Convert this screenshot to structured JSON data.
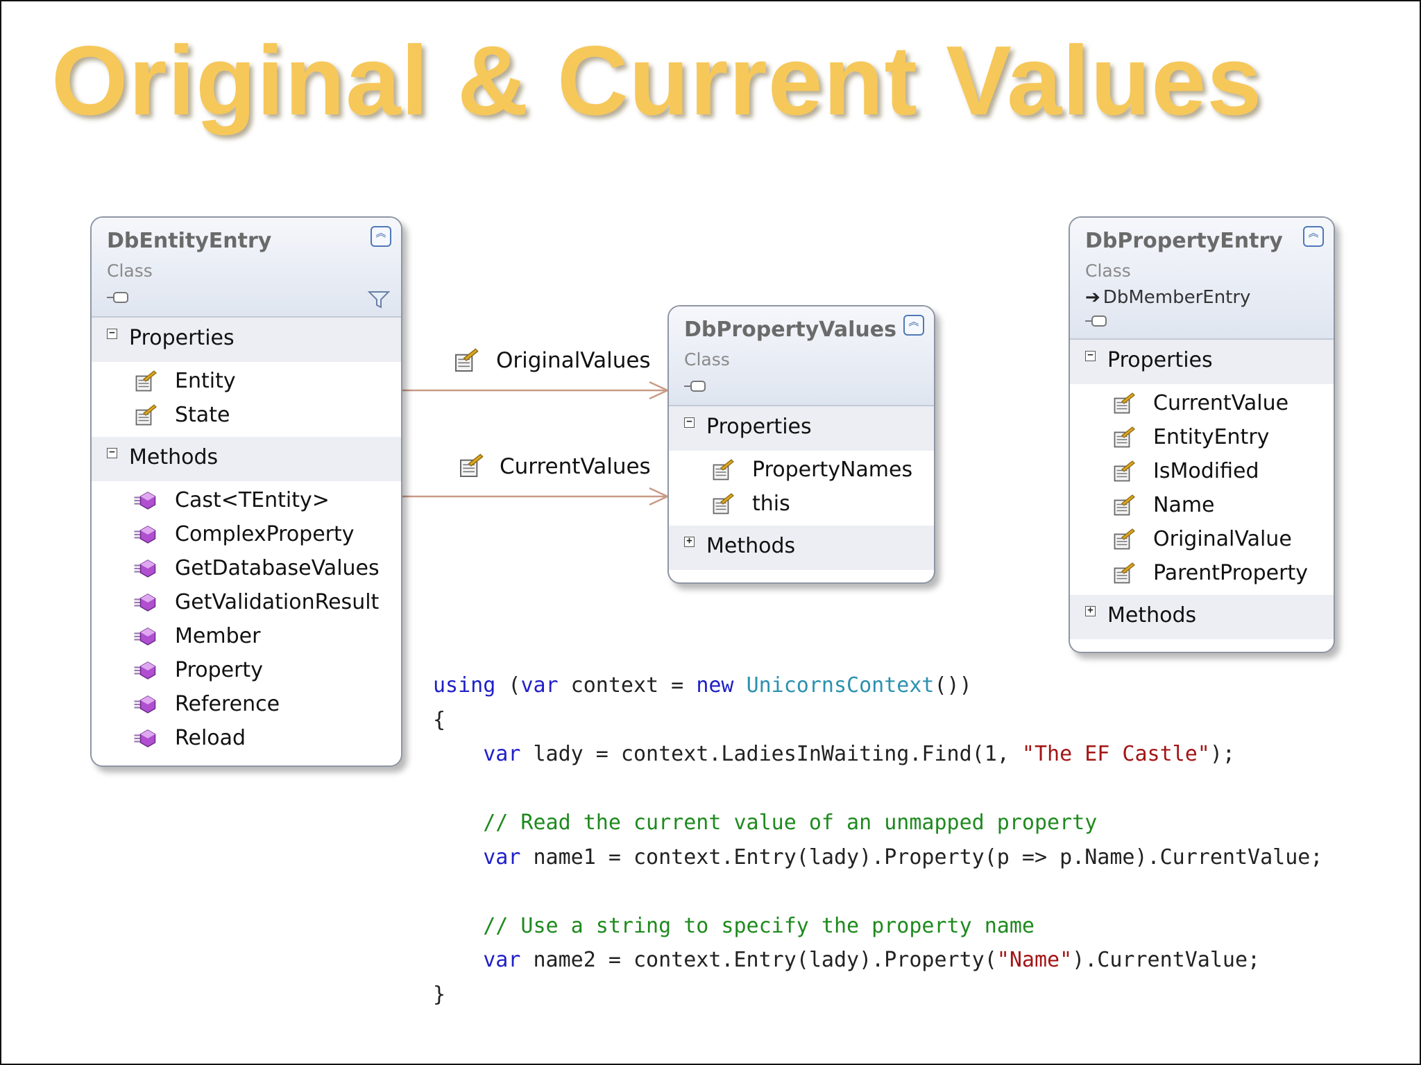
{
  "title": "Original & Current Values",
  "classes": {
    "db_entity_entry": {
      "name": "DbEntityEntry",
      "kind": "Class",
      "sections": [
        {
          "label": "Properties",
          "expanded": true,
          "members": [
            "Entity",
            "State"
          ]
        },
        {
          "label": "Methods",
          "expanded": true,
          "members": [
            "Cast<TEntity>",
            "ComplexProperty",
            "GetDatabaseValues",
            "GetValidationResult",
            "Member",
            "Property",
            "Reference",
            "Reload"
          ]
        }
      ]
    },
    "db_property_values": {
      "name": "DbPropertyValues",
      "kind": "Class",
      "sections": [
        {
          "label": "Properties",
          "expanded": true,
          "members": [
            "PropertyNames",
            "this"
          ]
        },
        {
          "label": "Methods",
          "expanded": false,
          "members": []
        }
      ]
    },
    "db_property_entry": {
      "name": "DbPropertyEntry",
      "kind": "Class",
      "inherits": "DbMemberEntry",
      "sections": [
        {
          "label": "Properties",
          "expanded": true,
          "members": [
            "CurrentValue",
            "EntityEntry",
            "IsModified",
            "Name",
            "OriginalValue",
            "ParentProperty"
          ]
        },
        {
          "label": "Methods",
          "expanded": false,
          "members": []
        }
      ]
    }
  },
  "associations": [
    {
      "label": "OriginalValues",
      "from": "DbEntityEntry",
      "to": "DbPropertyValues"
    },
    {
      "label": "CurrentValues",
      "from": "DbEntityEntry",
      "to": "DbPropertyValues"
    }
  ],
  "code": {
    "language": "csharp",
    "lines": [
      [
        {
          "t": "kw",
          "v": "using"
        },
        {
          "t": "plain",
          "v": " ("
        },
        {
          "t": "kw",
          "v": "var"
        },
        {
          "t": "plain",
          "v": " context = "
        },
        {
          "t": "kw",
          "v": "new"
        },
        {
          "t": "plain",
          "v": " "
        },
        {
          "t": "type",
          "v": "UnicornsContext"
        },
        {
          "t": "plain",
          "v": "())"
        }
      ],
      [
        {
          "t": "plain",
          "v": "{"
        }
      ],
      [
        {
          "t": "plain",
          "v": "    "
        },
        {
          "t": "kw",
          "v": "var"
        },
        {
          "t": "plain",
          "v": " lady = context.LadiesInWaiting.Find(1, "
        },
        {
          "t": "str",
          "v": "\"The EF Castle\""
        },
        {
          "t": "plain",
          "v": ");"
        }
      ],
      [],
      [
        {
          "t": "plain",
          "v": "    "
        },
        {
          "t": "cmt",
          "v": "// Read the current value of an unmapped property"
        }
      ],
      [
        {
          "t": "plain",
          "v": "    "
        },
        {
          "t": "kw",
          "v": "var"
        },
        {
          "t": "plain",
          "v": " name1 = context.Entry(lady).Property(p => p.Name).CurrentValue;"
        }
      ],
      [],
      [
        {
          "t": "plain",
          "v": "    "
        },
        {
          "t": "cmt",
          "v": "// Use a string to specify the property name"
        }
      ],
      [
        {
          "t": "plain",
          "v": "    "
        },
        {
          "t": "kw",
          "v": "var"
        },
        {
          "t": "plain",
          "v": " name2 = context.Entry(lady).Property("
        },
        {
          "t": "str",
          "v": "\"Name\""
        },
        {
          "t": "plain",
          "v": ").CurrentValue;"
        }
      ],
      [
        {
          "t": "plain",
          "v": "}"
        }
      ]
    ]
  }
}
